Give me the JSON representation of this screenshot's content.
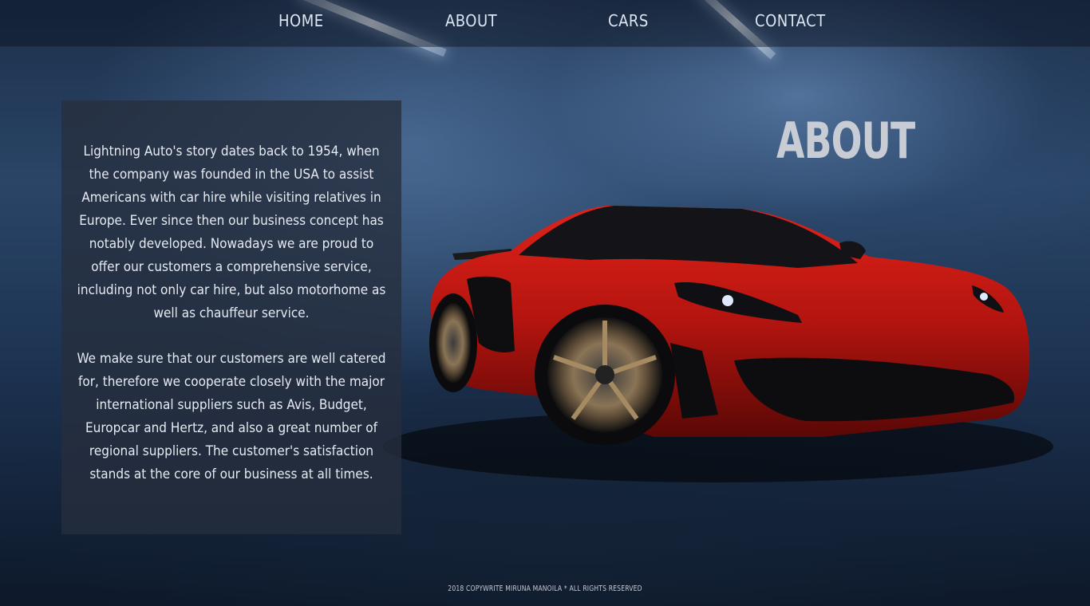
{
  "nav": {
    "items": [
      {
        "label": "HOME"
      },
      {
        "label": "ABOUT"
      },
      {
        "label": "CARS"
      },
      {
        "label": "CONTACT"
      }
    ]
  },
  "hero": {
    "heading": "ABOUT"
  },
  "about": {
    "paragraphs": [
      "Lightning Auto's story dates back to 1954, when the company was founded in the USA to assist Americans with car hire while visiting relatives in Europe. Ever since then our business concept has notably developed. Nowadays we are proud to offer our customers a comprehensive service, including not only car hire, but also motorhome as well as chauffeur service.",
      "We make sure that our customers are well catered for, therefore we cooperate closely with the major international suppliers such as Avis, Budget, Europcar and Hertz, and also a great number of regional suppliers. The customer's satisfaction stands at the core of our business at all times."
    ]
  },
  "footer": {
    "text": "2018 COPYWRITE MIRUNA MANOILA * ALL RIGHTS RESERVED"
  },
  "colors": {
    "background": "#1d3352",
    "panel": "#262e3e",
    "car_body": "#b3140f",
    "text": "#e6ebf2"
  }
}
